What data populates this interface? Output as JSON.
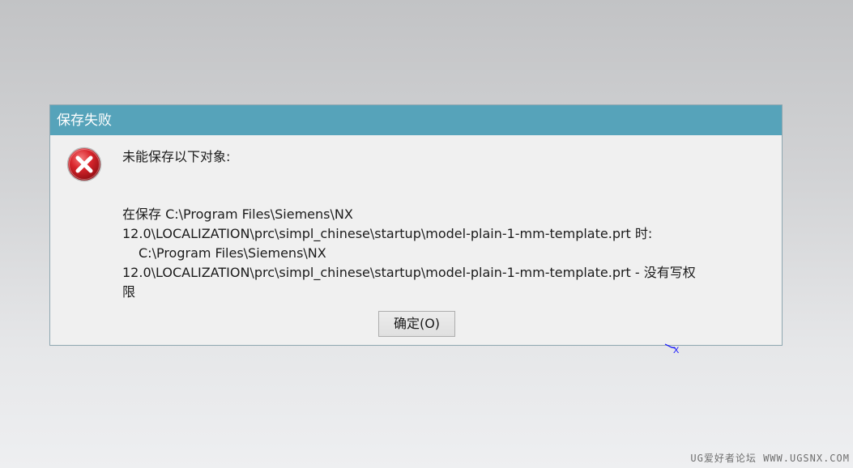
{
  "dialog": {
    "title": "保存失败",
    "heading": "未能保存以下对象:",
    "body_lines": [
      "在保存 C:\\Program Files\\Siemens\\NX",
      "12.0\\LOCALIZATION\\prc\\simpl_chinese\\startup\\model-plain-1-mm-template.prt 时:",
      "C:\\Program Files\\Siemens\\NX",
      "12.0\\LOCALIZATION\\prc\\simpl_chinese\\startup\\model-plain-1-mm-template.prt -  没有写权",
      "限"
    ],
    "ok_label": "确定(O)",
    "icon": "error-icon"
  },
  "canvas": {
    "axis_label": "X"
  },
  "watermark": "UG爱好者论坛 WWW.UGSNX.COM",
  "colors": {
    "title_bar": "#56a3ba",
    "dialog_bg": "#f0f0f0",
    "error_red": "#c8141c",
    "axis_blue": "#1010ff"
  }
}
